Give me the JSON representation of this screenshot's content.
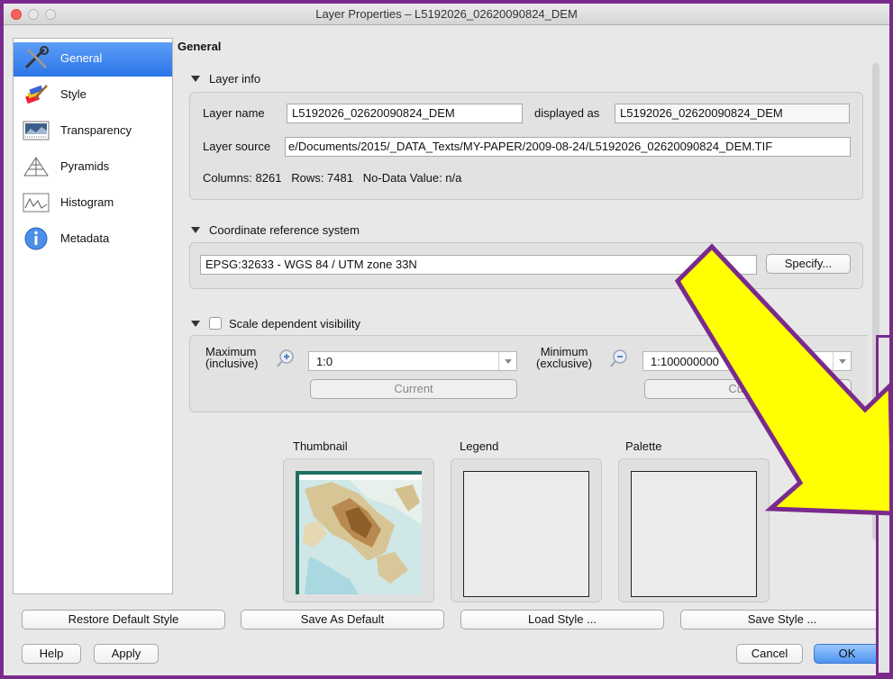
{
  "window": {
    "title": "Layer Properties – L5192026_02620090824_DEM"
  },
  "sidebar": {
    "items": [
      {
        "label": "General",
        "icon": "wrench-icon"
      },
      {
        "label": "Style",
        "icon": "paintbrush-icon"
      },
      {
        "label": "Transparency",
        "icon": "transparency-icon"
      },
      {
        "label": "Pyramids",
        "icon": "pyramid-icon"
      },
      {
        "label": "Histogram",
        "icon": "histogram-icon"
      },
      {
        "label": "Metadata",
        "icon": "info-icon"
      }
    ]
  },
  "main": {
    "section_title": "General",
    "layer_info": {
      "header": "Layer info",
      "layer_name_label": "Layer name",
      "layer_name_value": "L5192026_02620090824_DEM",
      "displayed_as_label": "displayed as",
      "displayed_as_value": "L5192026_02620090824_DEM",
      "layer_source_label": "Layer source",
      "layer_source_value": "e/Documents/2015/_DATA_Texts/MY-PAPER/2009-08-24/L5192026_02620090824_DEM.TIF",
      "columns_text": "Columns: 8261   Rows: 7481   No-Data Value: n/a"
    },
    "crs": {
      "header": "Coordinate reference system",
      "value": "EPSG:32633 - WGS 84 / UTM zone 33N",
      "specify_button": "Specify..."
    },
    "scale": {
      "header": "Scale dependent visibility",
      "maximum_label_1": "Maximum",
      "maximum_label_2": "(inclusive)",
      "maximum_value": "1:0",
      "minimum_label_1": "Minimum",
      "minimum_label_2": "(exclusive)",
      "minimum_value": "1:100000000",
      "current_button": "Current"
    },
    "previews": {
      "thumbnail_label": "Thumbnail",
      "legend_label": "Legend",
      "palette_label": "Palette"
    }
  },
  "footer": {
    "restore_default_style": "Restore Default Style",
    "save_as_default": "Save As Default",
    "load_style": "Load Style ...",
    "save_style": "Save Style ...",
    "help": "Help",
    "apply": "Apply",
    "cancel": "Cancel",
    "ok": "OK"
  },
  "colors": {
    "frame_border": "#7a2a8c",
    "arrow_fill": "#ffff00",
    "arrow_outline": "#7a2a8c",
    "selection": "#3a84ee"
  }
}
